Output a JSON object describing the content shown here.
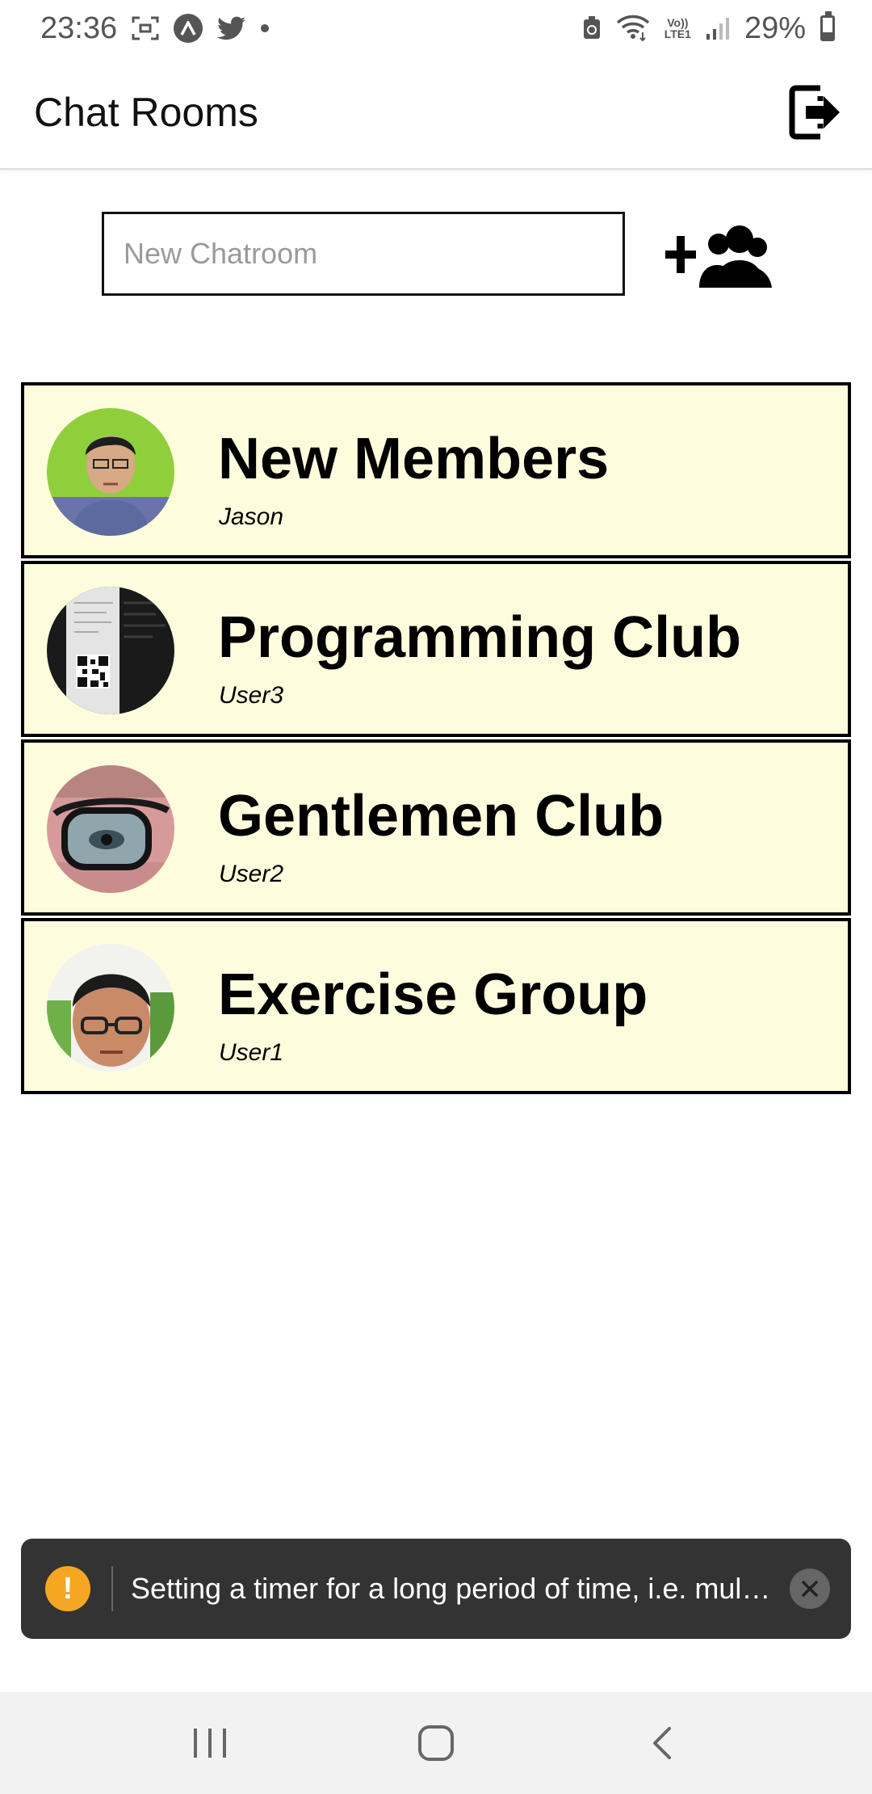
{
  "status_bar": {
    "time": "23:36",
    "icons_left": [
      "screenshot-icon",
      "a-circle-icon",
      "twitter-icon",
      "dot-icon"
    ],
    "network_label_top": "Vo))",
    "network_label_bottom": "LTE1",
    "battery": "29%",
    "battery_level": 0.29
  },
  "header": {
    "title": "Chat Rooms",
    "logout_icon": "logout-icon"
  },
  "new_chatroom": {
    "placeholder": "New Chatroom",
    "value": "",
    "add_icon": "add-group-icon"
  },
  "rooms": [
    {
      "name": "New Members",
      "user": "Jason"
    },
    {
      "name": "Programming Club",
      "user": "User3"
    },
    {
      "name": "Gentlemen Club",
      "user": "User2"
    },
    {
      "name": "Exercise Group",
      "user": "User1"
    }
  ],
  "toast": {
    "message": "Setting a timer for a long period of time, i.e. multiple minutes, is a performance and correctness issue on Android",
    "icon": "warning-icon",
    "warning_glyph": "!"
  },
  "colors": {
    "room_background": "#fdfddd",
    "room_border": "#000000",
    "toast_background": "#333333",
    "warning": "#f5a623"
  }
}
